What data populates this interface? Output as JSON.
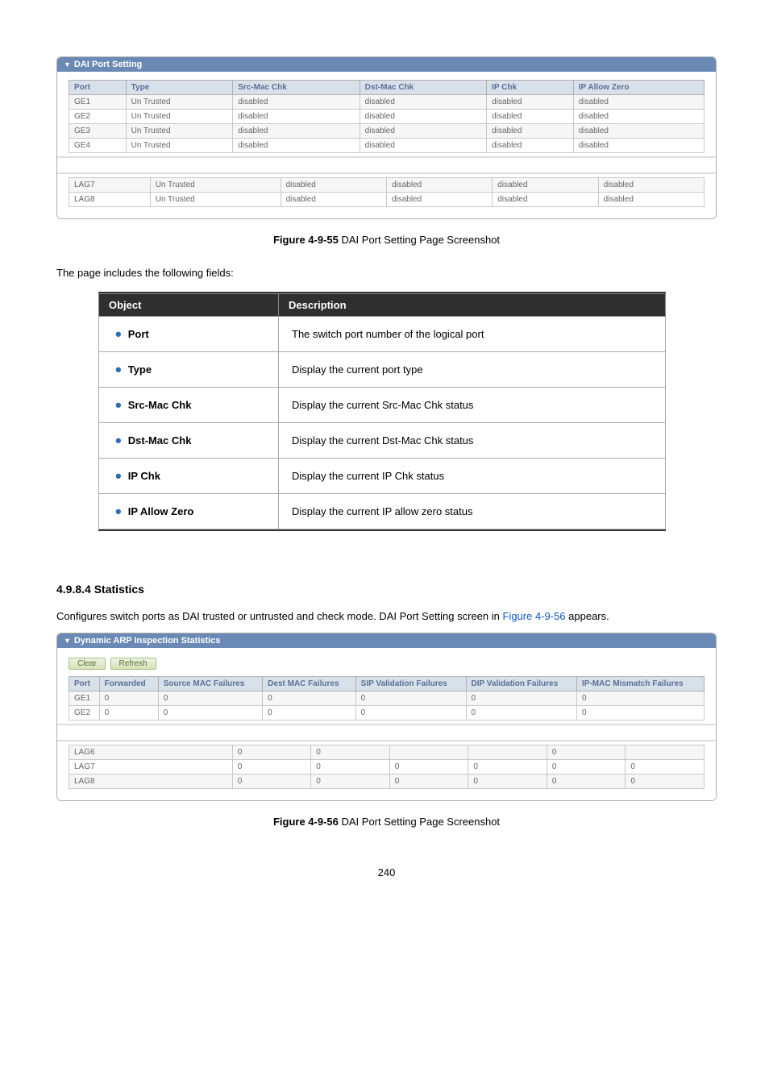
{
  "panel1": {
    "title": "DAI Port Setting",
    "headers": [
      "Port",
      "Type",
      "Src-Mac Chk",
      "Dst-Mac Chk",
      "IP Chk",
      "IP Allow Zero"
    ],
    "rows_top": [
      [
        "GE1",
        "Un Trusted",
        "disabled",
        "disabled",
        "disabled",
        "disabled"
      ],
      [
        "GE2",
        "Un Trusted",
        "disabled",
        "disabled",
        "disabled",
        "disabled"
      ],
      [
        "GE3",
        "Un Trusted",
        "disabled",
        "disabled",
        "disabled",
        "disabled"
      ],
      [
        "GE4",
        "Un Trusted",
        "disabled",
        "disabled",
        "disabled",
        "disabled"
      ]
    ],
    "rows_bottom": [
      [
        "LAG7",
        "Un Trusted",
        "disabled",
        "disabled",
        "disabled",
        "disabled"
      ],
      [
        "LAG8",
        "Un Trusted",
        "disabled",
        "disabled",
        "disabled",
        "disabled"
      ]
    ]
  },
  "caption1": {
    "bold": "Figure 4-9-55",
    "rest": " DAI Port Setting Page Screenshot"
  },
  "intro1": "The page includes the following fields:",
  "fields": {
    "header": {
      "object": "Object",
      "description": "Description"
    },
    "rows": [
      {
        "object": "Port",
        "description": "The switch port number of the logical port"
      },
      {
        "object": "Type",
        "description": "Display the current port type"
      },
      {
        "object": "Src-Mac Chk",
        "description": "Display the current Src-Mac Chk status"
      },
      {
        "object": "Dst-Mac Chk",
        "description": "Display the current Dst-Mac Chk status"
      },
      {
        "object": "IP Chk",
        "description": "Display the current IP Chk status"
      },
      {
        "object": "IP Allow Zero",
        "description": "Display the current IP allow zero status"
      }
    ]
  },
  "section": {
    "heading": "4.9.8.4 Statistics",
    "text_pre": "Configures switch ports as DAI trusted or untrusted and check mode. DAI Port Setting screen in ",
    "link": "Figure 4-9-56",
    "text_post": " appears."
  },
  "panel2": {
    "title": "Dynamic ARP Inspection Statistics",
    "buttons": {
      "clear": "Clear",
      "refresh": "Refresh"
    },
    "headers": [
      "Port",
      "Forwarded",
      "Source MAC Failures",
      "Dest MAC Failures",
      "SIP Validation Failures",
      "DIP Validation Failures",
      "IP-MAC Mismatch Failures"
    ],
    "rows_top": [
      [
        "GE1",
        "0",
        "0",
        "0",
        "0",
        "0",
        "0"
      ],
      [
        "GE2",
        "0",
        "0",
        "0",
        "0",
        "0",
        "0"
      ]
    ],
    "rows_bottom": [
      [
        "LAG6",
        "0",
        "0",
        "",
        "",
        "0",
        ""
      ],
      [
        "LAG7",
        "0",
        "0",
        "0",
        "0",
        "0",
        "0"
      ],
      [
        "LAG8",
        "0",
        "0",
        "0",
        "0",
        "0",
        "0"
      ]
    ]
  },
  "caption2": {
    "bold": "Figure 4-9-56",
    "rest": " DAI Port Setting Page Screenshot"
  },
  "page_number": "240"
}
